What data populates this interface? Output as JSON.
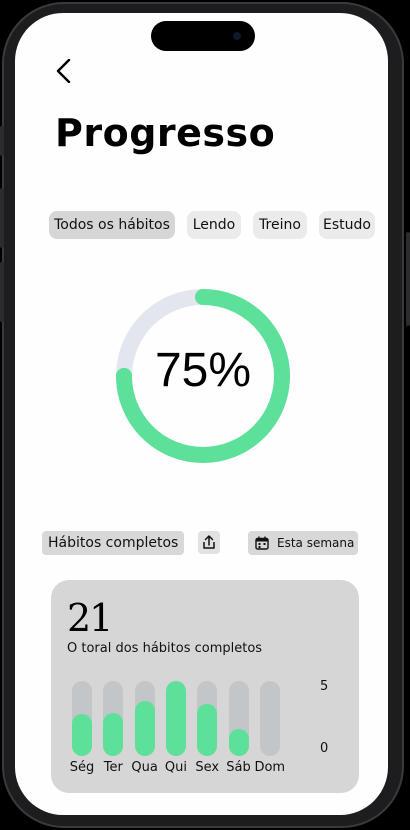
{
  "header": {
    "title": "Progresso"
  },
  "filters": [
    {
      "label": "Todos os hábitos",
      "active": true
    },
    {
      "label": "Lendo",
      "active": false
    },
    {
      "label": "Treino",
      "active": false
    },
    {
      "label": "Estudo",
      "active": false
    }
  ],
  "progress": {
    "value": 0.75,
    "label": "75%"
  },
  "summary": {
    "label": "Hábitos completos",
    "period_label": "Esta semana"
  },
  "card": {
    "total": "21",
    "subtitle": "O toral dos hábitos completos",
    "axis_max": "5",
    "axis_min": "0"
  },
  "chart_data": {
    "type": "bar",
    "categories": [
      "Ség",
      "Ter",
      "Qua",
      "Qui",
      "Sex",
      "Sáb",
      "Dom"
    ],
    "values": [
      2.8,
      2.9,
      3.7,
      5,
      3.5,
      1.8,
      0
    ],
    "ylim": [
      0,
      5
    ]
  },
  "colors": {
    "accent": "#5ce09a",
    "track": "#e3e6ee"
  },
  "icons": {
    "back": "chevron-left-icon",
    "share": "share-icon",
    "calendar": "calendar-icon"
  }
}
